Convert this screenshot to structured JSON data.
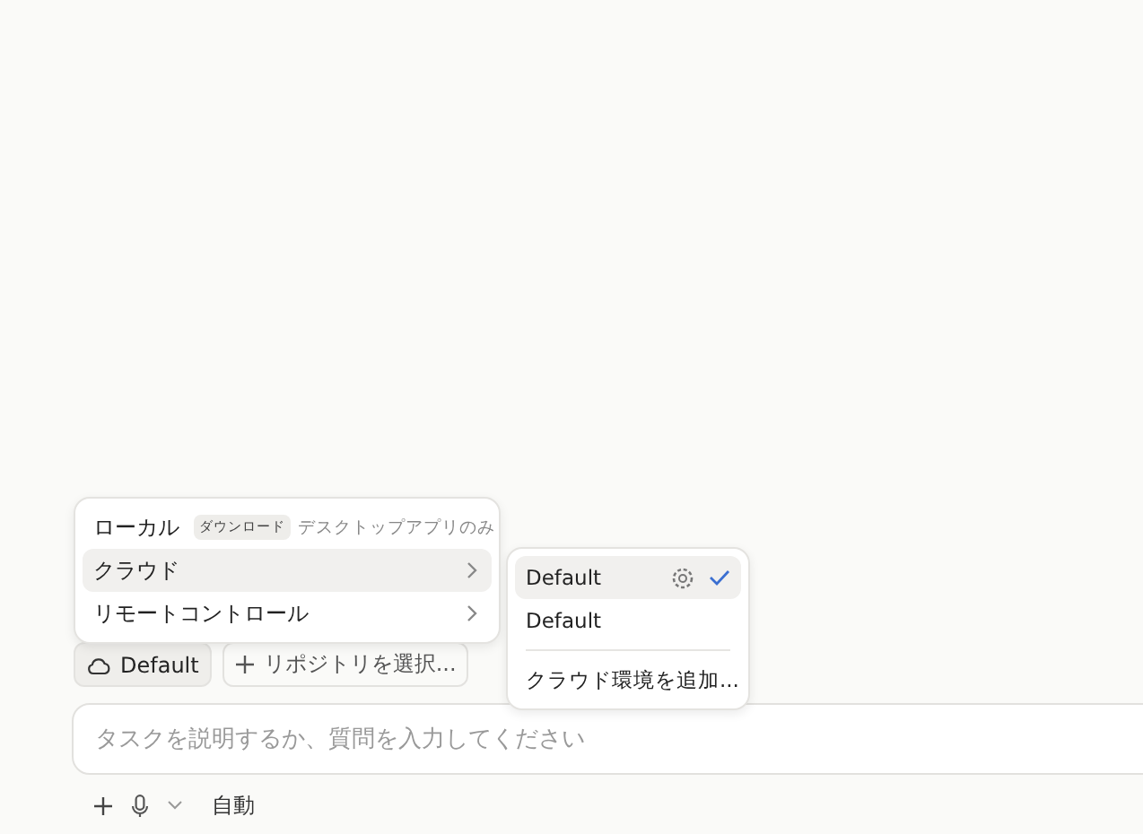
{
  "environment_menu": {
    "items": [
      {
        "label": "ローカル",
        "badge": "ダウンロード",
        "note": "デスクトップアプリのみ",
        "has_submenu": false,
        "selected": false
      },
      {
        "label": "クラウド",
        "has_submenu": true,
        "selected": true
      },
      {
        "label": "リモートコントロール",
        "has_submenu": true,
        "selected": false
      }
    ]
  },
  "cloud_submenu": {
    "items": [
      {
        "label": "Default",
        "settings": true,
        "selected": true
      },
      {
        "label": "Default",
        "settings": false,
        "selected": false
      }
    ],
    "action": "クラウド環境を追加..."
  },
  "chips": [
    {
      "kind": "cloud",
      "label": "Default"
    },
    {
      "kind": "add",
      "label": "リポジトリを選択..."
    }
  ],
  "prompt": {
    "placeholder": "タスクを説明するか、質問を入力してください"
  },
  "toolbar": {
    "mode": "自動"
  }
}
